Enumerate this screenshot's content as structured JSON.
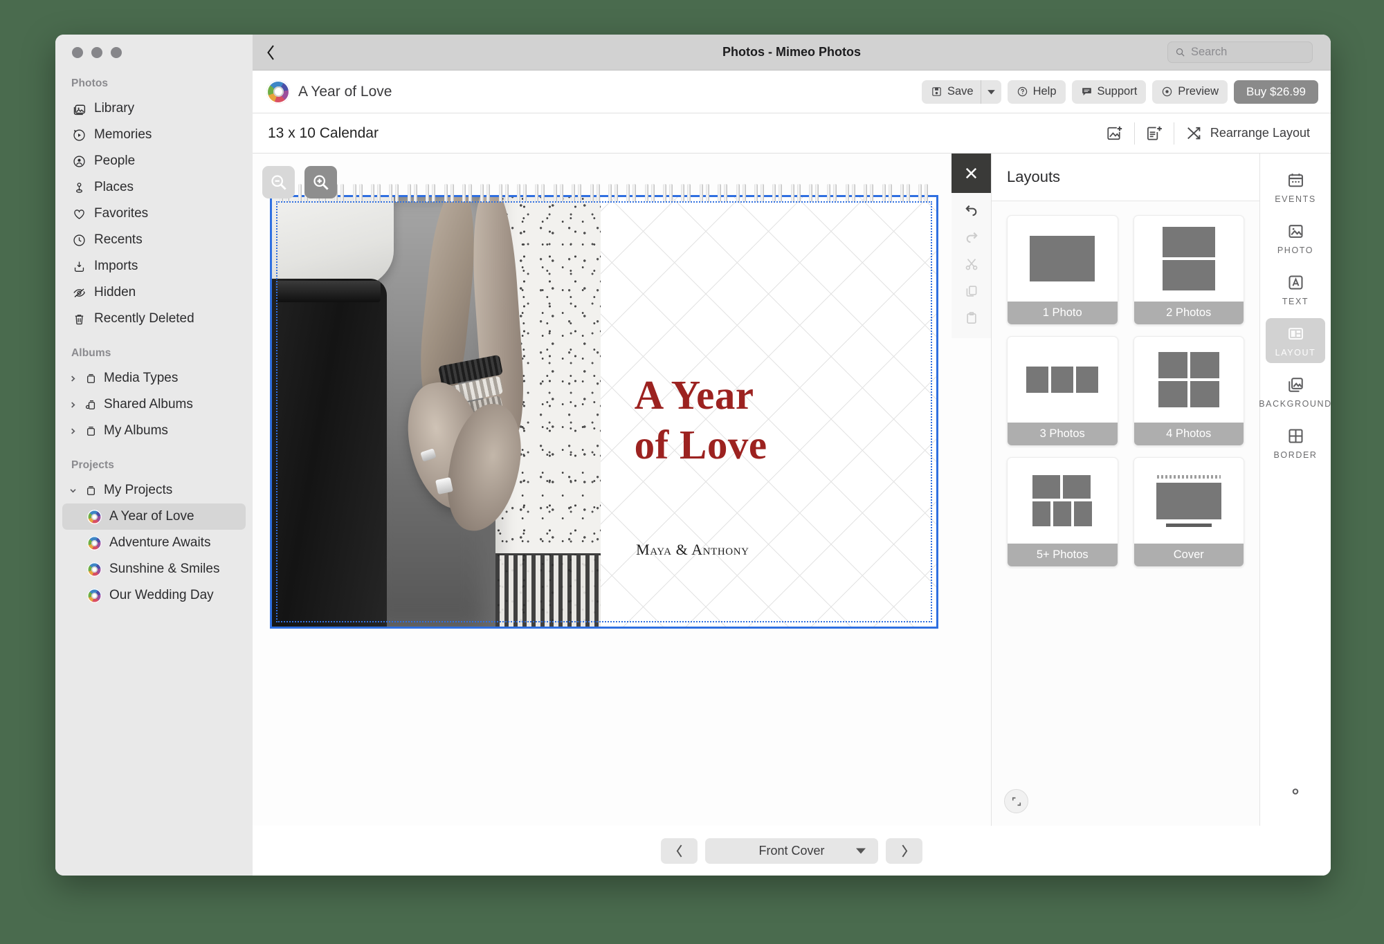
{
  "window": {
    "title": "Photos - Mimeo Photos",
    "back_icon": "chevron-left-icon",
    "search": {
      "placeholder": "Search",
      "icon": "search-icon",
      "value": ""
    }
  },
  "sidebar": {
    "sections": [
      {
        "label": "Photos",
        "items": [
          {
            "label": "Library",
            "icon": "library-icon"
          },
          {
            "label": "Memories",
            "icon": "memories-icon"
          },
          {
            "label": "People",
            "icon": "people-icon"
          },
          {
            "label": "Places",
            "icon": "places-pin-icon"
          },
          {
            "label": "Favorites",
            "icon": "heart-icon"
          },
          {
            "label": "Recents",
            "icon": "clock-icon"
          },
          {
            "label": "Imports",
            "icon": "import-icon"
          },
          {
            "label": "Hidden",
            "icon": "eye-slash-icon"
          },
          {
            "label": "Recently Deleted",
            "icon": "trash-icon"
          }
        ]
      },
      {
        "label": "Albums",
        "items": [
          {
            "label": "Media Types",
            "icon": "album-icon",
            "expanded": false
          },
          {
            "label": "Shared Albums",
            "icon": "shared-album-icon",
            "expanded": false
          },
          {
            "label": "My Albums",
            "icon": "album-icon",
            "expanded": false
          }
        ]
      },
      {
        "label": "Projects",
        "items": [
          {
            "label": "My Projects",
            "icon": "album-icon",
            "expanded": true
          },
          {
            "label": "A Year of Love",
            "icon": "mimeo-logo-icon",
            "selected": true
          },
          {
            "label": "Adventure Awaits",
            "icon": "mimeo-logo-icon",
            "selected": false
          },
          {
            "label": "Sunshine & Smiles",
            "icon": "mimeo-logo-icon",
            "selected": false
          },
          {
            "label": "Our Wedding Day",
            "icon": "mimeo-logo-icon",
            "selected": false
          }
        ]
      }
    ]
  },
  "project_toolbar": {
    "project_name": "A Year of Love",
    "logo_icon": "mimeo-logo-icon",
    "save_label": "Save",
    "save_icon": "floppy-disk-icon",
    "save_caret_icon": "caret-down-icon",
    "help_label": "Help",
    "help_icon": "question-circle-icon",
    "support_label": "Support",
    "support_icon": "chat-bubble-icon",
    "preview_label": "Preview",
    "preview_icon": "eye-icon",
    "buy_label": "Buy $26.99",
    "buy_color": "#8a8a8a"
  },
  "size_bar": {
    "size_label": "13 x 10 Calendar",
    "add_photo_icon": "add-photo-icon",
    "add_page_icon": "add-page-icon",
    "rearrange_label": "Rearrange Layout",
    "rearrange_icon": "shuffle-icon"
  },
  "canvas": {
    "zoom_out_icon": "zoom-out-icon",
    "zoom_in_icon": "zoom-in-icon",
    "cover": {
      "title_line1": "A Year",
      "title_line2": "of Love",
      "subtitle": "Maya & Anthony",
      "title_color": "#9c2220",
      "selection_color": "#2f6fe0",
      "photo_alt": "black-and-white photo of a couple holding hands"
    }
  },
  "float_toolbar": {
    "close_icon": "close-icon",
    "buttons": [
      {
        "icon": "undo-icon",
        "enabled": true
      },
      {
        "icon": "redo-icon",
        "enabled": false
      },
      {
        "icon": "cut-scissors-icon",
        "enabled": false
      },
      {
        "icon": "copy-icon",
        "enabled": false
      },
      {
        "icon": "paste-clipboard-icon",
        "enabled": false
      }
    ]
  },
  "page_nav": {
    "prev_icon": "chevron-left-icon",
    "next_icon": "chevron-right-icon",
    "current_page": "Front Cover",
    "dropdown_icon": "caret-down-icon"
  },
  "layouts_panel": {
    "title": "Layouts",
    "expand_icon": "expand-icon",
    "cards": [
      {
        "caption": "1 Photo",
        "kind": "one"
      },
      {
        "caption": "2 Photos",
        "kind": "two"
      },
      {
        "caption": "3 Photos",
        "kind": "three"
      },
      {
        "caption": "4 Photos",
        "kind": "four"
      },
      {
        "caption": "5+ Photos",
        "kind": "five"
      },
      {
        "caption": "Cover",
        "kind": "cover"
      }
    ]
  },
  "rail": {
    "items": [
      {
        "label": "EVENTS",
        "icon": "calendar-icon",
        "active": false
      },
      {
        "label": "PHOTO",
        "icon": "photo-icon",
        "active": false
      },
      {
        "label": "TEXT",
        "icon": "text-a-icon",
        "active": false
      },
      {
        "label": "LAYOUT",
        "icon": "layout-icon",
        "active": true
      },
      {
        "label": "BACKGROUND",
        "icon": "background-icon",
        "active": false
      },
      {
        "label": "BORDER",
        "icon": "border-grid-icon",
        "active": false
      }
    ],
    "gear_icon": "gear-icon"
  }
}
